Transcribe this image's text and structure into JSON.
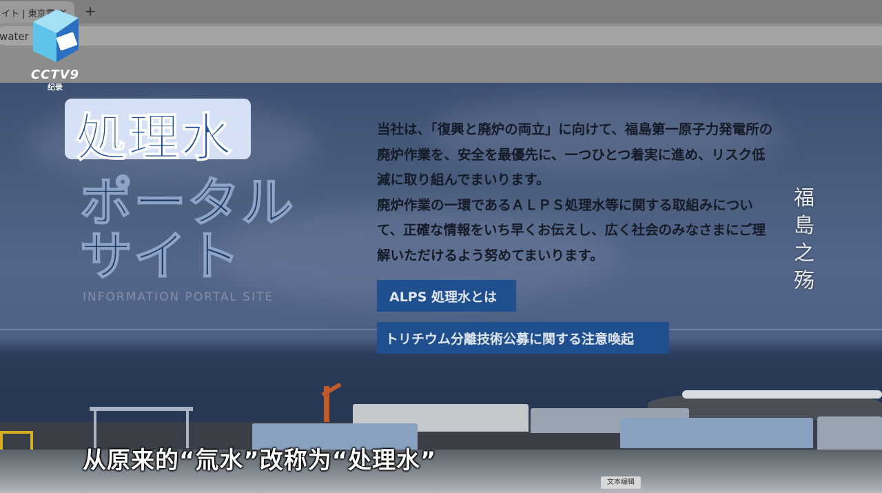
{
  "browser": {
    "tab_title": "イト | 東京電力",
    "tab_close": "×",
    "new_tab": "+",
    "url": "/water"
  },
  "broadcaster": {
    "logo_text": "CCTV9",
    "logo_sub": "纪录"
  },
  "logo": {
    "main": "処理水",
    "line1": "ポータル",
    "line2": "サイト",
    "english": "INFORMATION PORTAL SITE"
  },
  "intro": {
    "lines": [
      "当社は、「復興と廃炉の両立」に向けて、福島第一原子力発電所の",
      "廃炉作業を、安全を最優先に、一つひとつ着実に進め、リスク低",
      "減に取り組んでまいります。",
      "廃炉作業の一環であるＡＬＰＳ処理水等に関する取組みについ",
      "て、正確な情報をいち早くお伝えし、広く社会のみなさまにご理",
      "解いただけるよう努めてまいります。"
    ]
  },
  "buttons": {
    "alps": "ALPS 処理水とは",
    "tritium": "トリチウム分離技術公募に関する注意喚起"
  },
  "overlay": {
    "vertical_caption": [
      "福",
      "島",
      "之",
      "殇"
    ],
    "subtitle": "从原来的“氚水”改称为“处理水”",
    "edit_tag": "文本编辑"
  },
  "colors": {
    "logo_blue": "#1f4e9c",
    "button_blue": "#1f4f8f",
    "page_overlay": "#4a5d7e"
  }
}
